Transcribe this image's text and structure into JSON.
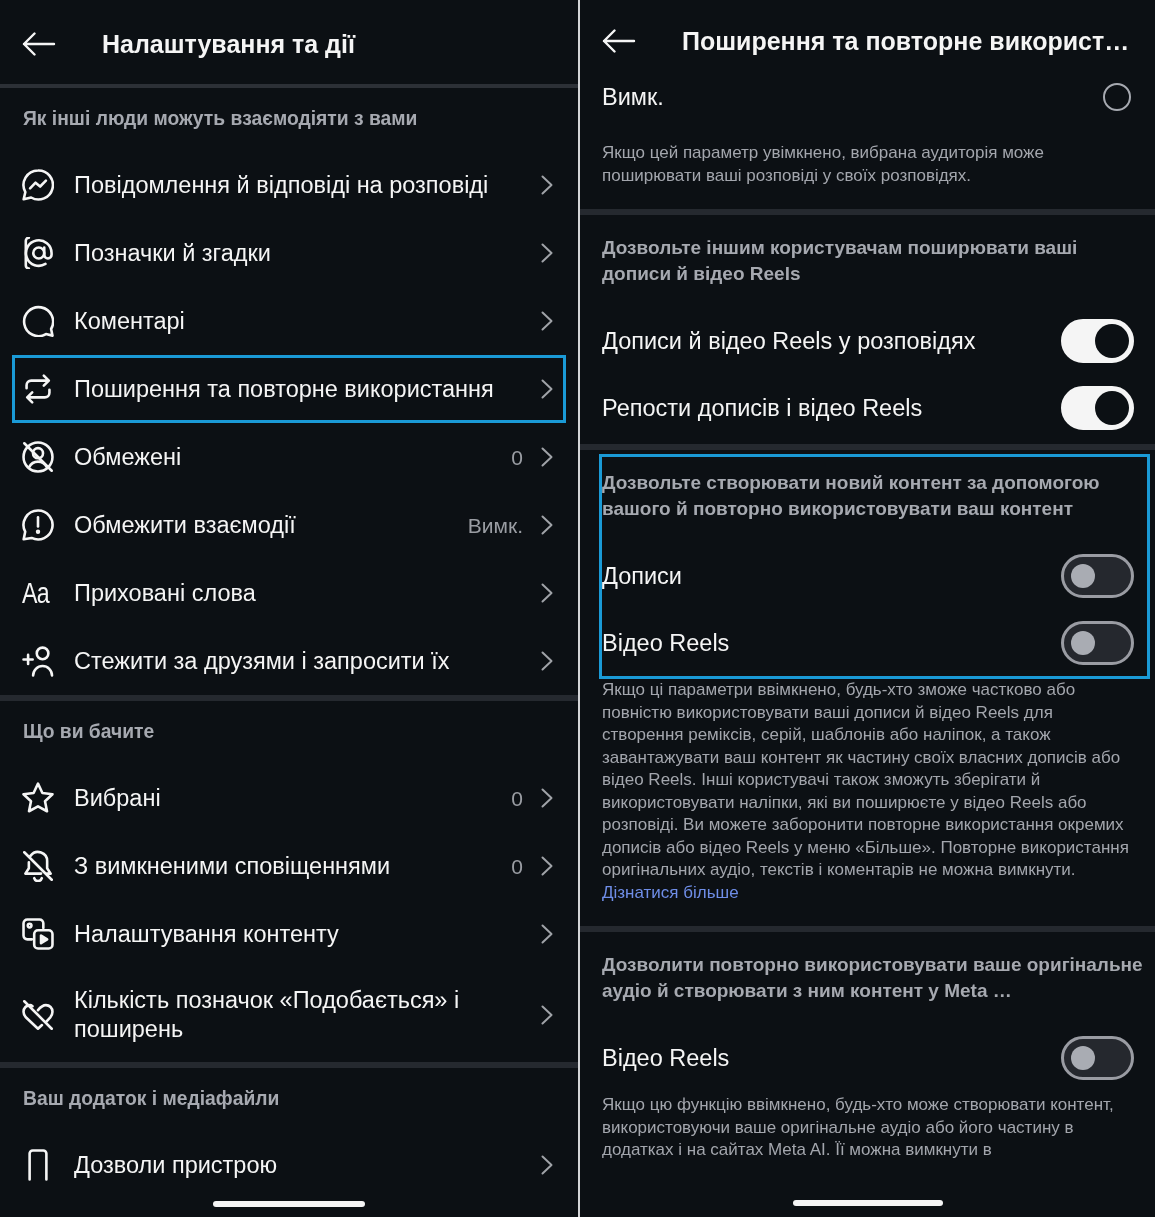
{
  "left_panel": {
    "header": {
      "title": "Налаштування та дії"
    },
    "sections": [
      {
        "heading": "Як інші люди можуть взаємодіяти з вами",
        "items": [
          {
            "label": "Повідомлення й відповіді на розповіді",
            "highlighted": false
          },
          {
            "label": "Позначки й згадки",
            "highlighted": false
          },
          {
            "label": "Коментарі",
            "highlighted": false
          },
          {
            "label": "Поширення та повторне використання",
            "highlighted": true
          },
          {
            "label": "Обмежені",
            "value": "0",
            "highlighted": false
          },
          {
            "label": "Обмежити взаємодії",
            "value": "Вимк.",
            "highlighted": false
          },
          {
            "label": "Приховані слова",
            "glyph": "Aa",
            "highlighted": false
          },
          {
            "label": "Стежити за друзями і запросити їх",
            "highlighted": false
          }
        ]
      },
      {
        "heading": "Що ви бачите",
        "items": [
          {
            "label": "Вибрані",
            "value": "0",
            "highlighted": false
          },
          {
            "label": "З вимкненими сповіщеннями",
            "value": "0",
            "highlighted": false
          },
          {
            "label": "Налаштування контенту",
            "highlighted": false
          },
          {
            "label": "Кількість позначок «Подобається» і поширень",
            "highlighted": false
          }
        ]
      },
      {
        "heading": "Ваш додаток і медіафайли",
        "items": [
          {
            "label": "Дозволи пристрою",
            "highlighted": false
          }
        ]
      }
    ]
  },
  "right_panel": {
    "header": {
      "title": "Поширення та повторне використ…"
    },
    "sections": [
      {
        "highlighted": false,
        "rows": [
          {
            "kind": "radio",
            "label": "Вимк.",
            "selected": false
          }
        ],
        "description": "Якщо цей параметр увімкнено, вибрана аудиторія може поширювати ваші розповіді у своїх розповідях."
      },
      {
        "heading": "Дозвольте іншим користувачам поширювати ваші дописи й відео Reels",
        "highlighted": false,
        "rows": [
          {
            "kind": "toggle",
            "label": "Дописи й відео Reels у розповідях",
            "on": true
          },
          {
            "kind": "toggle",
            "label": "Репости дописів і відео Reels",
            "on": true
          }
        ]
      },
      {
        "heading": "Дозвольте створювати новий контент за допомогою вашого й повторно використовувати ваш контент",
        "highlighted": true,
        "rows": [
          {
            "kind": "toggle",
            "label": "Дописи",
            "on": false
          },
          {
            "kind": "toggle",
            "label": "Відео Reels",
            "on": false
          }
        ],
        "description": "Якщо ці параметри ввімкнено, будь-хто зможе частково або повністю використовувати ваші дописи й відео Reels для створення реміксів, серій, шаблонів або наліпок, а також завантажувати ваш контент як частину своїх власних дописів або відео Reels. Інші користувачі також зможуть зберігати й використовувати наліпки, які ви поширюєте у відео Reels або розповіді. Ви можете заборонити повторне використання окремих дописів або відео Reels у меню «Більше». Повторне використання оригінальних аудіо, текстів і коментарів не можна вимкнути.",
        "link": "Дізнатися більше"
      },
      {
        "heading": "Дозволити повторно використовувати ваше оригінальне аудіо й створювати з ним контент у Meta …",
        "highlighted": false,
        "rows": [
          {
            "kind": "toggle",
            "label": "Відео Reels",
            "on": false
          }
        ],
        "description": "Якщо цю функцію ввімкнено, будь-хто може створювати контент, використовуючи ваше оригінальне аудіо або його частину в додатках і на сайтах Meta AI. Її можна вимкнути в"
      }
    ]
  }
}
